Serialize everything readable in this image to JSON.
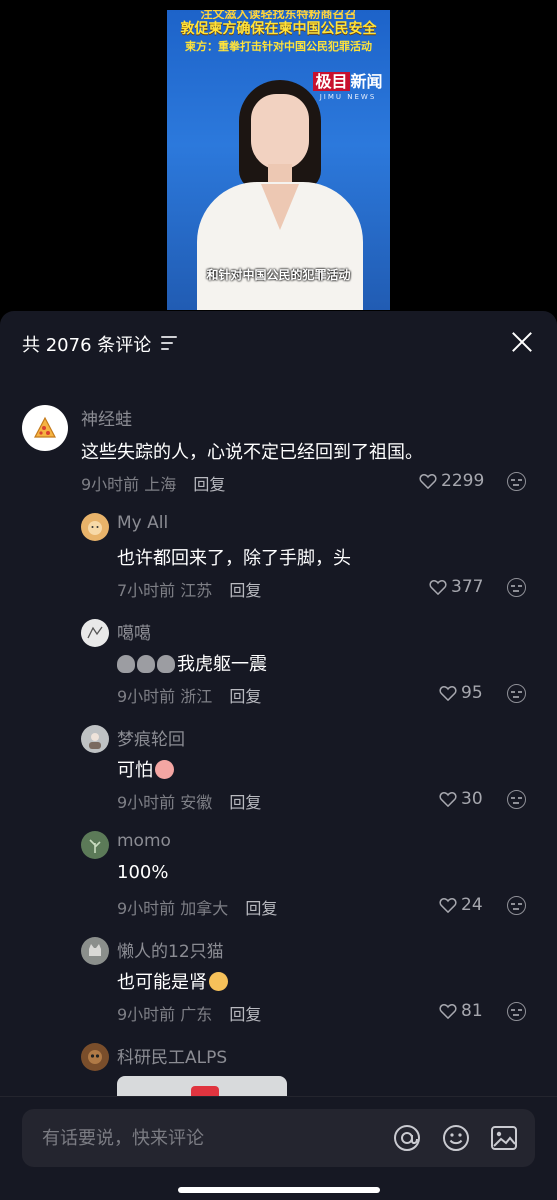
{
  "video": {
    "headline_top": "注文滋入读轻找东特粉商召召",
    "headline_main": "敦促柬方确保在柬中国公民安全",
    "headline_sub": "柬方：重拳打击针对中国公民犯罪活动",
    "logo_cn_box": "极目",
    "logo_cn_rest": "新闻",
    "logo_en": "JIMU NEWS",
    "subtitle": "和针对中国公民的犯罪活动"
  },
  "panel": {
    "title": "共 2076 条评论",
    "sort_icon": "sort-filter-icon",
    "close_icon": "close-icon"
  },
  "comments": [
    {
      "user": "神经蛙",
      "text": "这些失踪的人，心说不定已经回到了祖国。",
      "time": "9小时前",
      "location": "上海",
      "reply": "回复",
      "likes": "2299"
    },
    {
      "user": "My All",
      "text": "也许都回来了，除了手脚，头",
      "time": "7小时前",
      "location": "江苏",
      "reply": "回复",
      "likes": "377"
    },
    {
      "user": "噶噶",
      "text": "我虎躯一震",
      "time": "9小时前",
      "location": "浙江",
      "reply": "回复",
      "likes": "95"
    },
    {
      "user": "梦痕轮回",
      "text": "可怕",
      "time": "9小时前",
      "location": "安徽",
      "reply": "回复",
      "likes": "30"
    },
    {
      "user": "momo",
      "text": "100%",
      "time": "9小时前",
      "location": "加拿大",
      "reply": "回复",
      "likes": "24"
    },
    {
      "user": "懒人的12只猫",
      "text": "也可能是肾",
      "time": "9小时前",
      "location": "广东",
      "reply": "回复",
      "likes": "81"
    },
    {
      "user": "科研民工ALPS"
    }
  ],
  "input": {
    "placeholder": "有话要说，快来评论",
    "at_icon": "at-icon",
    "emoji_icon": "emoji-icon",
    "image_icon": "image-icon"
  },
  "colors": {
    "panel_bg": "#161823",
    "text_primary": "#ffffff",
    "text_secondary": "#8b8c93",
    "headline_yellow": "#ffe33a"
  }
}
